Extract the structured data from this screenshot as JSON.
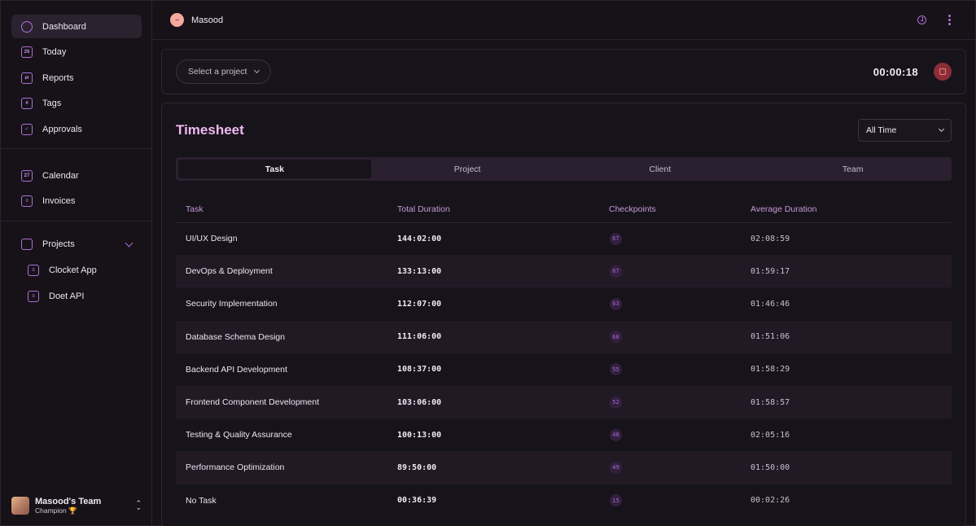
{
  "sidebar": {
    "items": [
      {
        "label": "Dashboard",
        "icon": "dashboard-icon",
        "glyph": ""
      },
      {
        "label": "Today",
        "icon": "calendar-day-icon",
        "glyph": "26"
      },
      {
        "label": "Reports",
        "icon": "reports-icon",
        "glyph": "⇄"
      },
      {
        "label": "Tags",
        "icon": "tag-icon",
        "glyph": "#"
      },
      {
        "label": "Approvals",
        "icon": "check-icon",
        "glyph": "✓"
      },
      {
        "label": "Calendar",
        "icon": "calendar-icon",
        "glyph": "27"
      },
      {
        "label": "Invoices",
        "icon": "invoice-icon",
        "glyph": "≡"
      }
    ],
    "projects_label": "Projects",
    "projects": [
      {
        "label": "Clocket App"
      },
      {
        "label": "Doet API"
      }
    ],
    "team": {
      "name": "Masood's Team",
      "role": "Champion 🏆"
    }
  },
  "topbar": {
    "user_name": "Masood"
  },
  "timer": {
    "project_placeholder": "Select a project",
    "elapsed": "00:00:18"
  },
  "timesheet": {
    "title": "Timesheet",
    "range": "All Time",
    "tabs": [
      "Task",
      "Project",
      "Client",
      "Team"
    ],
    "active_tab": "Task",
    "columns": [
      "Task",
      "Total Duration",
      "Checkpoints",
      "Average Duration"
    ],
    "rows": [
      {
        "task": "UI/UX Design",
        "total": "144:02:00",
        "checkpoints": "67",
        "average": "02:08:59"
      },
      {
        "task": "DevOps & Deployment",
        "total": "133:13:00",
        "checkpoints": "67",
        "average": "01:59:17"
      },
      {
        "task": "Security Implementation",
        "total": "112:07:00",
        "checkpoints": "63",
        "average": "01:46:46"
      },
      {
        "task": "Database Schema Design",
        "total": "111:06:00",
        "checkpoints": "60",
        "average": "01:51:06"
      },
      {
        "task": "Backend API Development",
        "total": "108:37:00",
        "checkpoints": "55",
        "average": "01:58:29"
      },
      {
        "task": "Frontend Component Development",
        "total": "103:06:00",
        "checkpoints": "52",
        "average": "01:58:57"
      },
      {
        "task": "Testing & Quality Assurance",
        "total": "100:13:00",
        "checkpoints": "48",
        "average": "02:05:16"
      },
      {
        "task": "Performance Optimization",
        "total": "89:50:00",
        "checkpoints": "49",
        "average": "01:50:00"
      },
      {
        "task": "No Task",
        "total": "00:36:39",
        "checkpoints": "15",
        "average": "00:02:26"
      }
    ]
  },
  "colors": {
    "accent": "#b070d8",
    "title": "#f0b8f0",
    "background": "#161218",
    "stop": "#8a2e38"
  }
}
